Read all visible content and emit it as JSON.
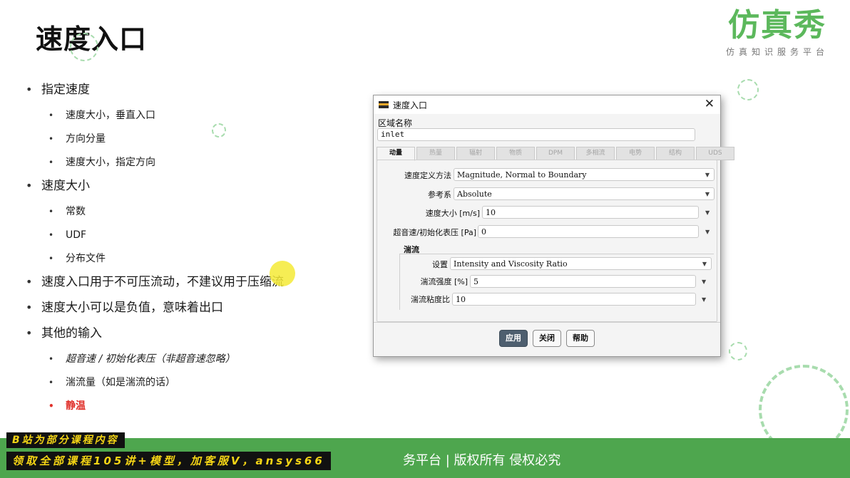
{
  "slide": {
    "title": "速度入口"
  },
  "logo": {
    "main": "仿真秀",
    "sub": "仿真知识服务平台"
  },
  "bullets": [
    {
      "level": 1,
      "text": "指定速度"
    },
    {
      "level": 2,
      "text": "速度大小，垂直入口"
    },
    {
      "level": 2,
      "text": "方向分量"
    },
    {
      "level": 2,
      "text": "速度大小，指定方向"
    },
    {
      "level": 1,
      "text": "速度大小"
    },
    {
      "level": 2,
      "text": "常数"
    },
    {
      "level": 2,
      "text": "UDF"
    },
    {
      "level": 2,
      "text": "分布文件"
    },
    {
      "level": 1,
      "text": "速度入口用于不可压流动，不建议用于压缩流"
    },
    {
      "level": 1,
      "text": "速度大小可以是负值，意味着出口"
    },
    {
      "level": 1,
      "text": "其他的输入"
    },
    {
      "level": 2,
      "text": "超音速 / 初始化表压（非超音速忽略）",
      "style": "italic"
    },
    {
      "level": 2,
      "text": "湍流量（如是湍流的话）"
    },
    {
      "level": 2,
      "text": "静温",
      "style": "red"
    }
  ],
  "dialog": {
    "title": "速度入口",
    "close": "✕",
    "zone_label": "区域名称",
    "zone_value": "inlet",
    "tabs": [
      "动量",
      "热量",
      "辐射",
      "物质",
      "DPM",
      "多相流",
      "电势",
      "结构",
      "UDS"
    ],
    "active_tab": "动量",
    "fields": {
      "velocity_method_label": "速度定义方法",
      "velocity_method_value": "Magnitude, Normal to Boundary",
      "reference_frame_label": "参考系",
      "reference_frame_value": "Absolute",
      "velocity_magnitude_label": "速度大小 [m/s]",
      "velocity_magnitude_value": "10",
      "pressure_label": "超音速/初始化表压 [Pa]",
      "pressure_value": "0"
    },
    "turbulence": {
      "title": "湍流",
      "spec_label": "设置",
      "spec_value": "Intensity and Viscosity Ratio",
      "intensity_label": "湍流强度 [%]",
      "intensity_value": "5",
      "viscosity_ratio_label": "湍流粘度比",
      "viscosity_ratio_value": "10"
    },
    "buttons": {
      "apply": "应用",
      "close": "关闭",
      "help": "帮助"
    }
  },
  "banner": {
    "text": "务平台 | 版权所有 侵权必究",
    "overlay_line1": "B站为部分课程内容",
    "overlay_line2": "领取全部课程105讲+模型，加客服V，ansys66"
  },
  "colors": {
    "banner_green": "#4ea64e",
    "logo_green": "#5cb85c",
    "overlay_yellow": "#f5d515",
    "static_temp_red": "#e0302a"
  }
}
